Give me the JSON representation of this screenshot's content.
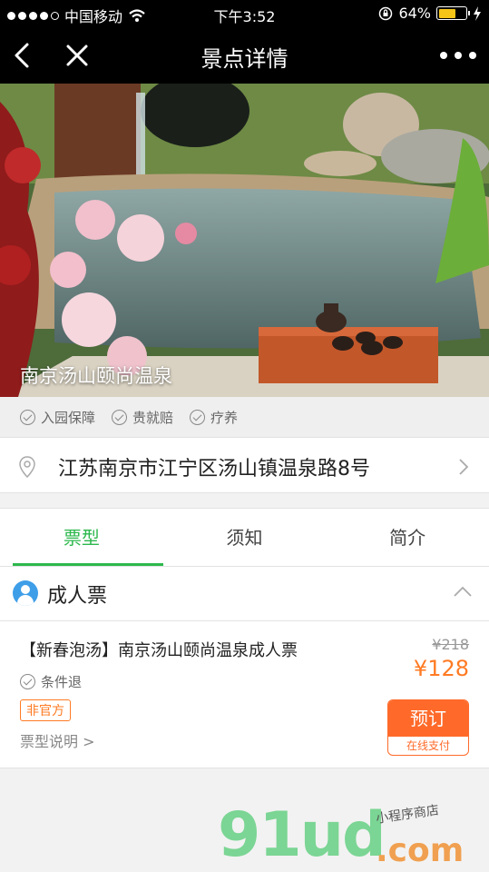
{
  "status": {
    "carrier": "中国移动",
    "time": "下午3:52",
    "battery": "64%",
    "battery_level": 0.64
  },
  "nav": {
    "title": "景点详情",
    "back_icon": "chevron-left-icon",
    "close_icon": "close-icon",
    "more_icon": "more-icon"
  },
  "hero": {
    "caption": "南京汤山颐尚温泉"
  },
  "guarantees": [
    "入园保障",
    "贵就赔",
    "疗养"
  ],
  "address": {
    "text": "江苏南京市江宁区汤山镇温泉路8号"
  },
  "tabs": [
    {
      "label": "票型"
    },
    {
      "label": "须知"
    },
    {
      "label": "简介"
    }
  ],
  "section": {
    "title": "成人票"
  },
  "ticket": {
    "name": "【新春泡汤】南京汤山颐尚温泉成人票",
    "original_price": "¥218",
    "price": "¥128",
    "refund": "条件退",
    "tag": "非官方",
    "desc": "票型说明 >",
    "book_label": "预订",
    "pay_label": "在线支付"
  },
  "watermark": {
    "logo": "91ud",
    "domain": ".com",
    "slogan": "小程序商店"
  },
  "colors": {
    "accent": "#2db84d",
    "price": "#ff7a22",
    "book": "#ff6a2a"
  }
}
